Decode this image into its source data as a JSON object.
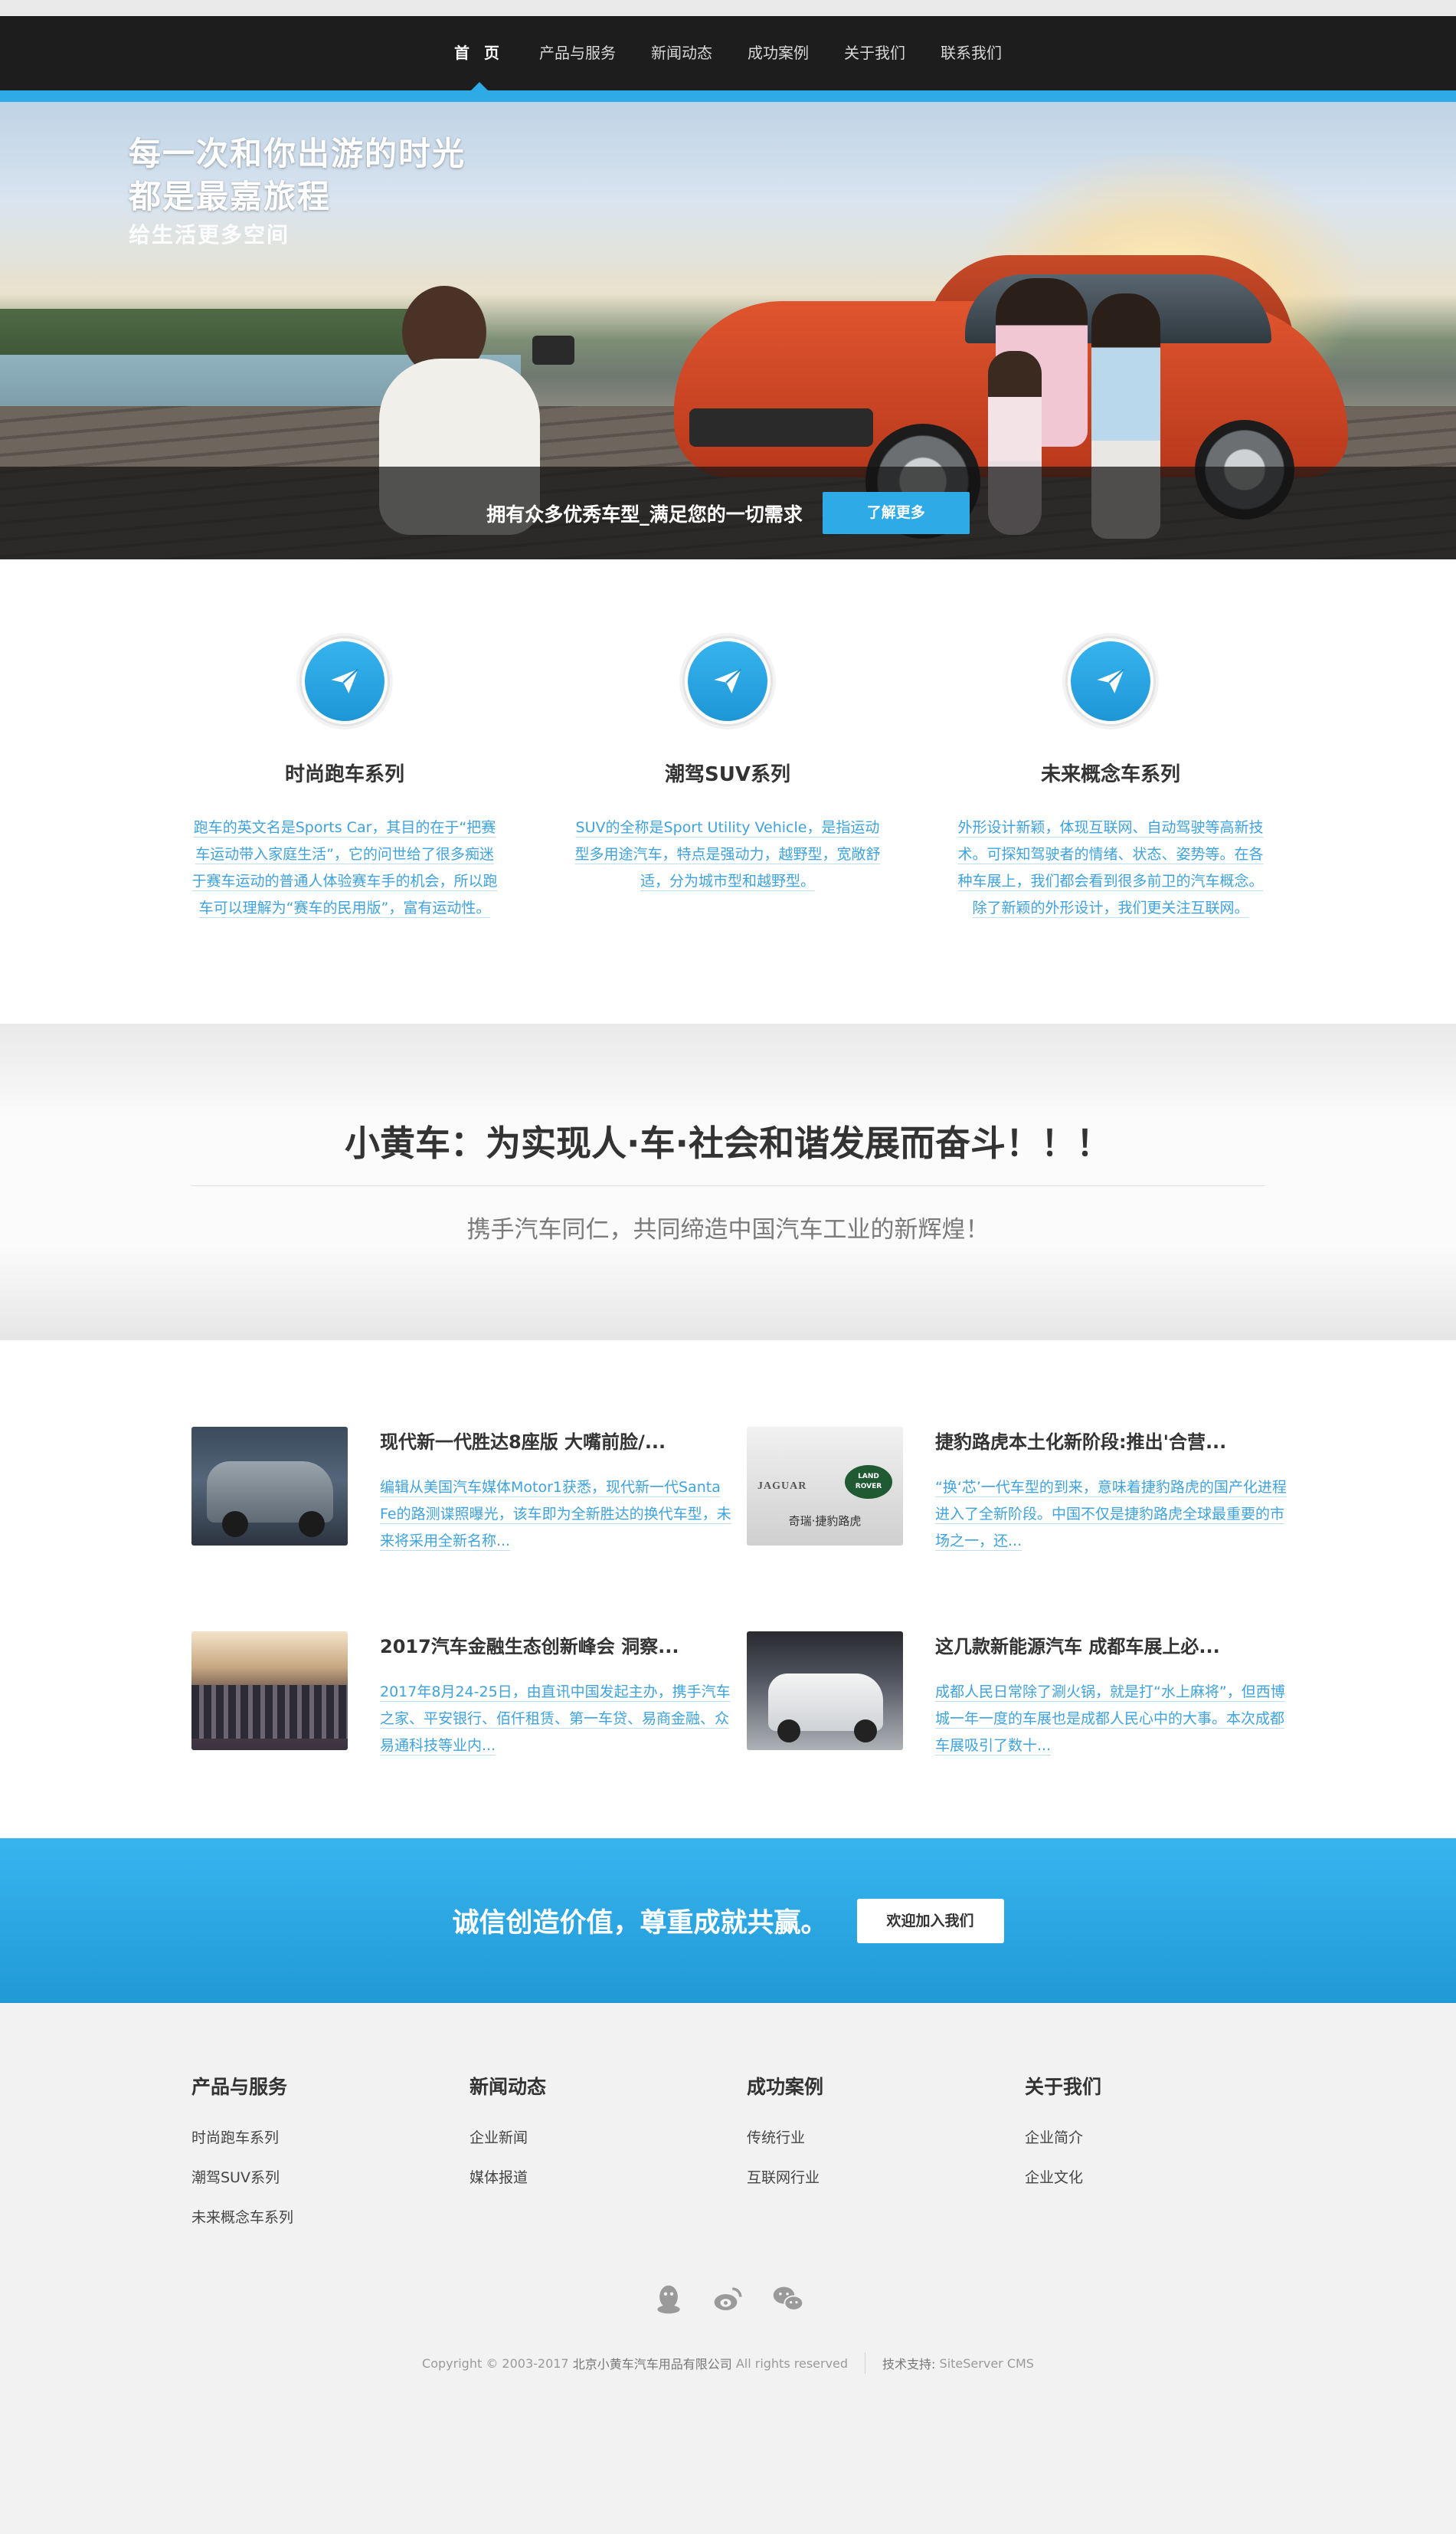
{
  "nav": {
    "items": [
      {
        "label": "首 页",
        "active": true
      },
      {
        "label": "产品与服务"
      },
      {
        "label": "新闻动态"
      },
      {
        "label": "成功案例"
      },
      {
        "label": "关于我们"
      },
      {
        "label": "联系我们"
      }
    ]
  },
  "hero": {
    "title_line1": "每一次和你出游的时光",
    "title_line2": "都是最嘉旅程",
    "subtitle": "给生活更多空间",
    "band_text": "拥有众多优秀车型_满足您的一切需求",
    "button": "了解更多"
  },
  "features": [
    {
      "title": "时尚跑车系列",
      "desc": "跑车的英文名是Sports Car，其目的在于“把赛车运动带入家庭生活”，它的问世给了很多痴迷于赛车运动的普通人体验赛车手的机会，所以跑车可以理解为“赛车的民用版”，富有运动性。"
    },
    {
      "title": "潮驾SUV系列",
      "desc": "SUV的全称是Sport Utility Vehicle，是指运动型多用途汽车，特点是强动力，越野型，宽敞舒适，分为城市型和越野型。"
    },
    {
      "title": "未来概念车系列",
      "desc": "外形设计新颖，体现互联网、自动驾驶等高新技术。可探知驾驶者的情绪、状态、姿势等。在各种车展上，我们都会看到很多前卫的汽车概念。除了新颖的外形设计，我们更关注互联网。"
    }
  ],
  "slogan": {
    "title": "小黄车：为实现人·车·社会和谐发展而奋斗！！！",
    "subtitle": "携手汽车同仁，共同缔造中国汽车工业的新辉煌！"
  },
  "news": [
    {
      "title": "现代新一代胜达8座版 大嘴前脸/...",
      "desc": "编辑从美国汽车媒体Motor1获悉，现代新一代Santa Fe的路测谍照曝光，该车即为全新胜达的换代车型，未来将采用全新名称..."
    },
    {
      "title": "捷豹路虎本土化新阶段:推出'合营...",
      "desc": "“换‘芯’一代车型的到来，意味着捷豹路虎的国产化进程进入了全新阶段。中国不仅是捷豹路虎全球最重要的市场之一，还..."
    },
    {
      "title": "2017汽车金融生态创新峰会 洞察...",
      "desc": "2017年8月24-25日，由直讯中国发起主办，携手汽车之家、平安银行、佰仟租赁、第一车贷、易商金融、众易通科技等业内..."
    },
    {
      "title": "这几款新能源汽车 成都车展上必...",
      "desc": "成都人民日常除了涮火锅，就是打“水上麻将”，但西博城一年一度的车展也是成都人民心中的大事。本次成都车展吸引了数十..."
    }
  ],
  "news_thumb_labels": {
    "jaguar": "JAGUAR",
    "landrover_top": "LAND",
    "landrover_bottom": "ROVER",
    "caption": "奇瑞·捷豹路虎"
  },
  "cta": {
    "text": "诚信创造价值，尊重成就共赢。",
    "button": "欢迎加入我们"
  },
  "footer": {
    "columns": [
      {
        "title": "产品与服务",
        "links": [
          "时尚跑车系列",
          "潮驾SUV系列",
          "未来概念车系列"
        ]
      },
      {
        "title": "新闻动态",
        "links": [
          "企业新闻",
          "媒体报道"
        ]
      },
      {
        "title": "成功案例",
        "links": [
          "传统行业",
          "互联网行业"
        ]
      },
      {
        "title": "关于我们",
        "links": [
          "企业简介",
          "企业文化"
        ]
      }
    ],
    "social_icons": [
      "qq-icon",
      "weibo-icon",
      "wechat-icon"
    ],
    "copyright_prefix": "Copyright © 2003-2017",
    "company": "北京小黄车汽车用品有限公司",
    "rights": "All rights reserved",
    "tech_label": "技术支持:",
    "tech_value": "SiteServer CMS"
  },
  "colors": {
    "accent": "#2eaae6",
    "nav_bg": "#1d1d1d",
    "link_blue": "#3da3e0"
  }
}
